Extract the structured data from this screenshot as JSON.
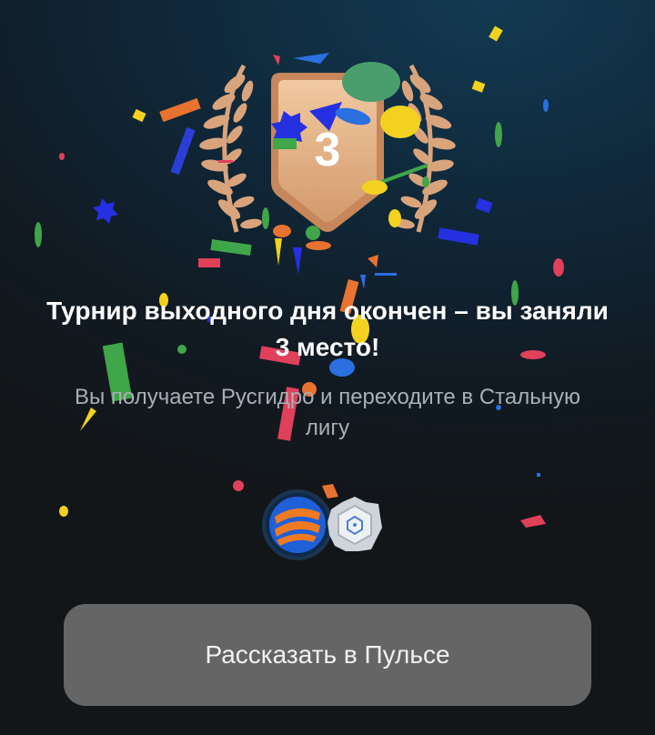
{
  "badge": {
    "place_number": "3",
    "badge_color": "#e3b38b",
    "laurel_color": "#d9a47c"
  },
  "result": {
    "title": "Турнир выходного дня окончен – вы заняли 3 место!",
    "subtitle": "Вы получаете Русгидро и переходите в Стальную лигу"
  },
  "rewards": {
    "items": [
      {
        "icon": "rushydro-logo-icon"
      },
      {
        "icon": "steel-league-icon"
      }
    ]
  },
  "actions": {
    "share_label": "Рассказать в Пульсе"
  },
  "colors": {
    "background": "#121619",
    "button_bg": "#656565",
    "title": "#ffffff",
    "subtitle": "#a9afb6"
  }
}
